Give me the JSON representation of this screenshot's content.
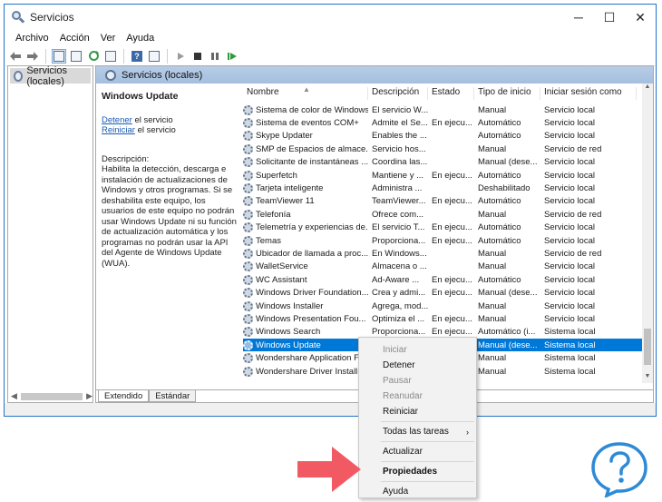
{
  "window": {
    "title": "Servicios",
    "controls": {
      "minimize": "─",
      "maximize": "☐",
      "close": "✕"
    }
  },
  "menubar": [
    "Archivo",
    "Acción",
    "Ver",
    "Ayuda"
  ],
  "sidepanel": {
    "item": "Servicios (locales)"
  },
  "main": {
    "header": "Servicios (locales)",
    "description": {
      "service_title": "Windows Update",
      "stop_link": "Detener",
      "stop_suffix": " el servicio",
      "restart_link": "Reiniciar",
      "restart_suffix": " el servicio",
      "label": "Descripción:",
      "text": "Habilita la detección, descarga e instalación de actualizaciones de Windows y otros programas. Si se deshabilita este equipo, los usuarios de este equipo no podrán usar Windows Update ni su función de actualización automática y los programas no podrán usar la API del Agente de Windows Update (WUA)."
    },
    "columns": [
      "Nombre",
      "Descripción",
      "Estado",
      "Tipo de inicio",
      "Iniciar sesión como"
    ],
    "rows": [
      [
        "Sistema de color de Windows",
        "El servicio W...",
        "",
        "Manual",
        "Servicio local"
      ],
      [
        "Sistema de eventos COM+",
        "Admite el Se...",
        "En ejecu...",
        "Automático",
        "Servicio local"
      ],
      [
        "Skype Updater",
        "Enables the ...",
        "",
        "Automático",
        "Servicio local"
      ],
      [
        "SMP de Espacios de almace...",
        "Servicio hos...",
        "",
        "Manual",
        "Servicio de red"
      ],
      [
        "Solicitante de instantáneas ...",
        "Coordina las...",
        "",
        "Manual (dese...",
        "Servicio local"
      ],
      [
        "Superfetch",
        "Mantiene y ...",
        "En ejecu...",
        "Automático",
        "Servicio local"
      ],
      [
        "Tarjeta inteligente",
        "Administra ...",
        "",
        "Deshabilitado",
        "Servicio local"
      ],
      [
        "TeamViewer 11",
        "TeamViewer...",
        "En ejecu...",
        "Automático",
        "Servicio local"
      ],
      [
        "Telefonía",
        "Ofrece com...",
        "",
        "Manual",
        "Servicio de red"
      ],
      [
        "Telemetría y experiencias de...",
        "El servicio T...",
        "En ejecu...",
        "Automático",
        "Servicio local"
      ],
      [
        "Temas",
        "Proporciona...",
        "En ejecu...",
        "Automático",
        "Servicio local"
      ],
      [
        "Ubicador de llamada a proc...",
        "En Windows...",
        "",
        "Manual",
        "Servicio de red"
      ],
      [
        "WalletService",
        "Almacena o ...",
        "",
        "Manual",
        "Servicio local"
      ],
      [
        "WC Assistant",
        "Ad-Aware ...",
        "En ejecu...",
        "Automático",
        "Servicio local"
      ],
      [
        "Windows Driver Foundation...",
        "Crea y admi...",
        "En ejecu...",
        "Manual (dese...",
        "Servicio local"
      ],
      [
        "Windows Installer",
        "Agrega, mod...",
        "",
        "Manual",
        "Servicio local"
      ],
      [
        "Windows Presentation Fou...",
        "Optimiza el ...",
        "En ejecu...",
        "Manual",
        "Servicio local"
      ],
      [
        "Windows Search",
        "Proporciona...",
        "En ejecu...",
        "Automático (i...",
        "Sistema local"
      ],
      [
        "Windows Update",
        "",
        "",
        "Manual (dese...",
        "Sistema local"
      ],
      [
        "Wondershare Application Fr...",
        "",
        "",
        "Manual",
        "Sistema local"
      ],
      [
        "Wondershare Driver Install S...",
        "",
        "",
        "Manual",
        "Sistema local"
      ]
    ],
    "selected_row": 18,
    "tabs": [
      "Extendido",
      "Estándar"
    ]
  },
  "context_menu": {
    "items": [
      {
        "label": "Iniciar",
        "disabled": true
      },
      {
        "label": "Detener",
        "disabled": false
      },
      {
        "label": "Pausar",
        "disabled": true
      },
      {
        "label": "Reanudar",
        "disabled": true
      },
      {
        "label": "Reiniciar",
        "disabled": false
      },
      {
        "sep": true
      },
      {
        "label": "Todas las tareas",
        "disabled": false,
        "submenu": "›"
      },
      {
        "sep": true
      },
      {
        "label": "Actualizar",
        "disabled": false
      },
      {
        "sep": true
      },
      {
        "label": "Propiedades",
        "disabled": false,
        "bold": true
      },
      {
        "sep": true
      },
      {
        "label": "Ayuda",
        "disabled": false
      }
    ]
  },
  "colors": {
    "selection": "#0078d7",
    "link": "#1c5bb3",
    "arrow": "#f25a63",
    "logo": "#2f8ad6"
  },
  "icons": {
    "toolbar": [
      "back-arrow-icon",
      "forward-arrow-icon",
      "console-tree-icon",
      "properties-icon",
      "refresh-icon",
      "export-icon",
      "help-icon",
      "view-icon",
      "play-icon",
      "stop-icon",
      "pause-icon",
      "restart-icon"
    ]
  }
}
